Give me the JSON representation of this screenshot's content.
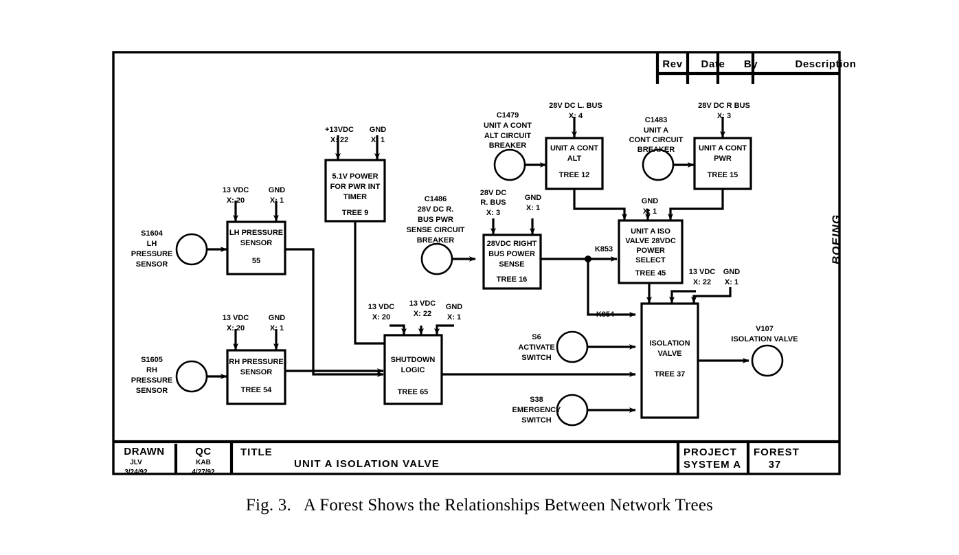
{
  "drawing": {
    "brand": "BOEING",
    "revision_table": {
      "columns": [
        "Rev",
        "Date",
        "By",
        "Description"
      ]
    },
    "title_block": {
      "drawn_label": "DRAWN",
      "drawn_by": "JLV",
      "drawn_date": "3/24/92",
      "qc_label": "QC",
      "qc_by": "KAB",
      "qc_date": "4/27/92",
      "title_label": "TITLE",
      "title_value": "UNIT A ISOLATION VALVE",
      "project_label": "PROJECT",
      "project_value": "SYSTEM A",
      "forest_label": "FOREST",
      "forest_value": "37"
    }
  },
  "caption": {
    "figure_number": "Fig. 3.",
    "text": "A Forest Shows the Relationships Between Network Trees"
  },
  "blocks": {
    "pwr_int_timer": {
      "l1": "5.1V POWER",
      "l2": "FOR PWR INT",
      "l3": "TIMER",
      "tree": "TREE  9"
    },
    "lh_pressure_sensor": {
      "l1": "LH PRESSURE",
      "l2": "SENSOR",
      "tree": "55"
    },
    "rh_pressure_sensor": {
      "l1": "RH PRESSURE",
      "l2": "SENSOR",
      "tree": "TREE 54"
    },
    "shutdown_logic": {
      "l1": "SHUTDOWN",
      "l2": "LOGIC",
      "tree": "TREE 65"
    },
    "bus_power_sense": {
      "l1": "28VDC RIGHT",
      "l2": "BUS POWER",
      "l3": "SENSE",
      "tree": "TREE 16"
    },
    "unit_a_cont_alt": {
      "l1": "UNIT A CONT",
      "l2": "ALT",
      "tree": "TREE 12"
    },
    "unit_a_cont_pwr": {
      "l1": "UNIT A CONT",
      "l2": "PWR",
      "tree": "TREE 15"
    },
    "iso_valve_power_select": {
      "l1": "UNIT A ISO",
      "l2": "VALVE 28VDC",
      "l3": "POWER",
      "l4": "SELECT",
      "tree": "TREE 45"
    },
    "isolation_valve": {
      "l1": "ISOLATION",
      "l2": "VALVE",
      "tree": "TREE 37"
    }
  },
  "sources": {
    "s1604": {
      "l1": "S1604",
      "l2": "LH",
      "l3": "PRESSURE",
      "l4": "SENSOR"
    },
    "s1605": {
      "l1": "S1605",
      "l2": "RH",
      "l3": "PRESSURE",
      "l4": "SENSOR"
    },
    "c1486": {
      "l1": "C1486",
      "l2": "28V DC R.",
      "l3": "BUS PWR",
      "l4": "SENSE CIRCUIT",
      "l5": "BREAKER"
    },
    "c1479": {
      "l1": "C1479",
      "l2": "UNIT A CONT",
      "l3": "ALT CIRCUIT",
      "l4": "BREAKER"
    },
    "c1483": {
      "l1": "C1483",
      "l2": "UNIT A",
      "l3": "CONT CIRCUIT",
      "l4": "BREAKER"
    },
    "s6": {
      "l1": "S6",
      "l2": "ACTIVATE",
      "l3": "SWITCH"
    },
    "s38": {
      "l1": "S38",
      "l2": "EMERGENCY",
      "l3": "SWITCH"
    },
    "v107": {
      "l1": "V107",
      "l2": "ISOLATION VALVE"
    }
  },
  "power_inputs": {
    "timer_vdc": {
      "name": "+13VDC",
      "x": "X:  22"
    },
    "timer_gnd": {
      "name": "GND",
      "x": "X:  1"
    },
    "lh_vdc": {
      "name": "13 VDC",
      "x": "X: 20"
    },
    "lh_gnd": {
      "name": "GND",
      "x": "X:  1"
    },
    "rh_vdc": {
      "name": "13 VDC",
      "x": "X: 20"
    },
    "rh_gnd": {
      "name": "GND",
      "x": "X:  1"
    },
    "sd_vdc20": {
      "name": "13 VDC",
      "x": "X: 20"
    },
    "sd_vdc22": {
      "name": "13 VDC",
      "x": "X: 22"
    },
    "sd_gnd": {
      "name": "GND",
      "x": "X:  1"
    },
    "sense_bus": {
      "name1": "28V DC",
      "name2": "R. BUS",
      "x": "X: 3"
    },
    "sense_gnd": {
      "name": "GND",
      "x": "X:  1"
    },
    "alt_bus": {
      "name": "28V DC L. BUS",
      "x": "X: 4"
    },
    "pwr_bus": {
      "name": "28V DC R BUS",
      "x": "X: 3"
    },
    "select_gnd": {
      "name": "GND",
      "x": "X:  1"
    },
    "valve_vdc": {
      "name": "13 VDC",
      "x": "X: 22"
    },
    "valve_gnd": {
      "name": "GND",
      "x": "X:  1"
    }
  },
  "signals": {
    "k853": "K853",
    "k854": "K854"
  }
}
